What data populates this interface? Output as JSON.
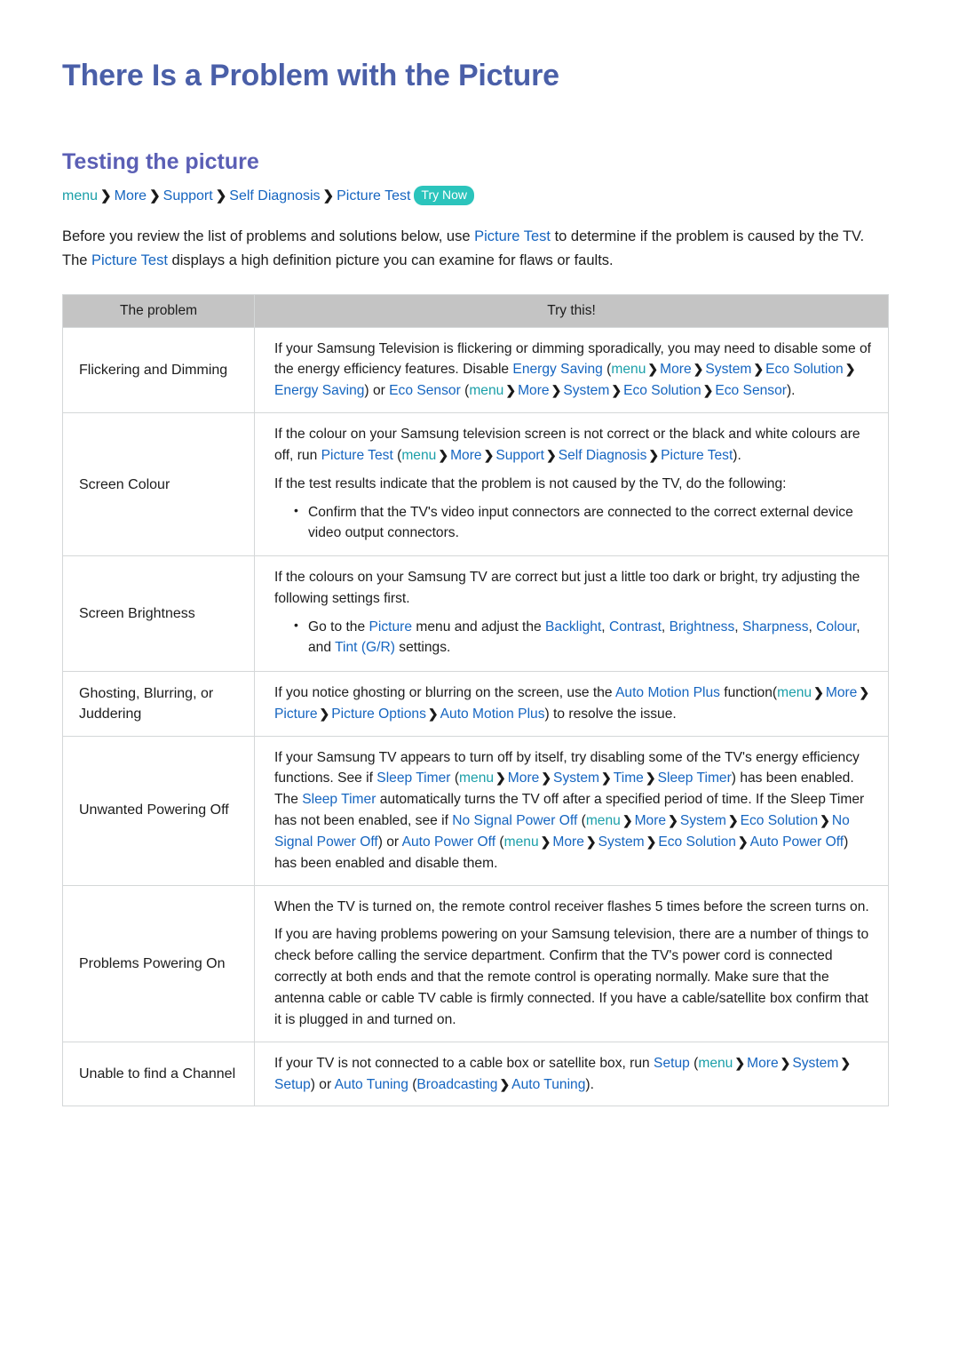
{
  "title": "There Is a Problem with the Picture",
  "section": {
    "heading": "Testing the picture",
    "breadcrumb": {
      "items": [
        "menu",
        "More",
        "Support",
        "Self Diagnosis",
        "Picture Test"
      ],
      "separator": "❯",
      "badge": "Try Now"
    },
    "intro": {
      "part1": "Before you review the list of problems and solutions below, use ",
      "link1": "Picture Test",
      "part2": " to determine if the problem is caused by the TV. The ",
      "link2": "Picture Test",
      "part3": " displays a high definition picture you can examine for flaws or faults."
    }
  },
  "table": {
    "headers": {
      "problem": "The problem",
      "try": "Try this!"
    },
    "rows": [
      {
        "problem": "Flickering and Dimming",
        "body": {
          "t1": "If your Samsung Television is flickering or dimming sporadically, you may need to disable some of the energy efficiency features. Disable ",
          "l1": "Energy Saving",
          "t2": " (",
          "m1": "menu",
          "l2": "More",
          "l3": "System",
          "l4": "Eco Solution",
          "l5": "Energy Saving",
          "t3": ") or ",
          "l6": "Eco Sensor",
          "t4": " (",
          "m2": "menu",
          "l7": "More",
          "l8": "System",
          "l9": "Eco Solution",
          "l10": "Eco Sensor",
          "t5": ")."
        }
      },
      {
        "problem": "Screen Colour",
        "body": {
          "t1": "If the colour on your Samsung television screen is not correct or the black and white colours are off, run ",
          "l1": "Picture Test",
          "t2": " (",
          "m1": "menu",
          "l2": "More",
          "l3": "Support",
          "l4": "Self Diagnosis",
          "l5": "Picture Test",
          "t3": ").",
          "p2": "If the test results indicate that the problem is not caused by the TV, do the following:",
          "bullet1": "Confirm that the TV's video input connectors are connected to the correct external device video output connectors."
        }
      },
      {
        "problem": "Screen Brightness",
        "body": {
          "p1": "If the colours on your Samsung TV are correct but just a little too dark or bright, try adjusting the following settings first.",
          "b1a": "Go to the ",
          "l1": "Picture",
          "b1b": " menu and adjust the ",
          "l2": "Backlight",
          "b1c": ", ",
          "l3": "Contrast",
          "b1d": ", ",
          "l4": "Brightness",
          "b1e": ", ",
          "l5": "Sharpness",
          "b1f": ", ",
          "l6": "Colour",
          "b1g": ", and ",
          "l7": "Tint (G/R)",
          "b1h": " settings."
        }
      },
      {
        "problem": "Ghosting, Blurring, or Juddering",
        "body": {
          "t1": "If you notice ghosting or blurring on the screen, use the ",
          "l1": "Auto Motion Plus",
          "t2": " function(",
          "m1": "menu",
          "l2": "More",
          "l3": "Picture",
          "l4": "Picture Options",
          "l5": "Auto Motion Plus",
          "t3": ") to resolve the issue."
        }
      },
      {
        "problem": "Unwanted Powering Off",
        "body": {
          "t1": "If your Samsung TV appears to turn off by itself, try disabling some of the TV's energy efficiency functions. See if ",
          "l1": "Sleep Timer",
          "t2": " (",
          "m1": "menu",
          "l2": "More",
          "l3": "System",
          "l4": "Time",
          "l5": "Sleep Timer",
          "t3": ") has been enabled. The ",
          "l6": "Sleep Timer",
          "t4": " automatically turns the TV off after a specified period of time. If the Sleep Timer has not been enabled, see if ",
          "l7": "No Signal Power Off",
          "t5": " (",
          "m2": "menu",
          "l8": "More",
          "l9": "System",
          "l10": "Eco Solution",
          "l11": "No Signal Power Off",
          "t6": ") or ",
          "l12": "Auto Power Off",
          "t7": " (",
          "m3": "menu",
          "l13": "More",
          "l14": "System",
          "l15": "Eco Solution",
          "l16": "Auto Power Off",
          "t8": ") has been enabled and disable them."
        }
      },
      {
        "problem": "Problems Powering On",
        "body": {
          "p1": "When the TV is turned on, the remote control receiver flashes 5 times before the screen turns on.",
          "p2": "If you are having problems powering on your Samsung television, there are a number of things to check before calling the service department. Confirm that the TV's power cord is connected correctly at both ends and that the remote control is operating normally. Make sure that the antenna cable or cable TV cable is firmly connected. If you have a cable/satellite box confirm that it is plugged in and turned on."
        }
      },
      {
        "problem": "Unable to find a Channel",
        "body": {
          "t1": "If your TV is not connected to a cable box or satellite box, run ",
          "l1": "Setup",
          "t2": " (",
          "m1": "menu",
          "l2": "More",
          "l3": "System",
          "l4": "Setup",
          "t3": ") or ",
          "l5": "Auto Tuning",
          "t4": " (",
          "l6": "Broadcasting",
          "l7": "Auto Tuning",
          "t5": ")."
        }
      }
    ]
  }
}
